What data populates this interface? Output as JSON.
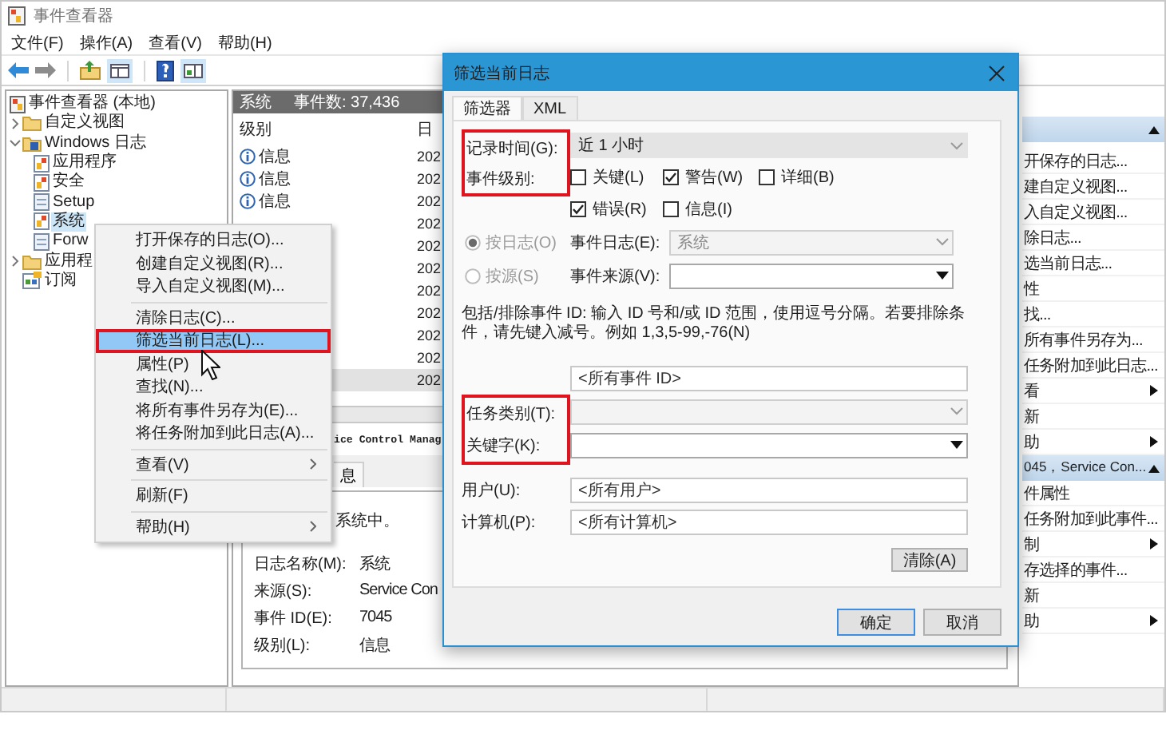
{
  "window": {
    "title": "事件查看器"
  },
  "menu_bar": [
    {
      "label": "文件(F)"
    },
    {
      "label": "操作(A)"
    },
    {
      "label": "查看(V)"
    },
    {
      "label": "帮助(H)"
    }
  ],
  "tree": [
    {
      "label": "事件查看器 (本地)",
      "kind": "root",
      "selected": false,
      "children": [
        {
          "label": "自定义视图",
          "kind": "folder",
          "expanded": false,
          "selected": false
        },
        {
          "label": "Windows 日志",
          "kind": "folder-log",
          "expanded": true,
          "selected": false,
          "children": [
            {
              "label": "应用程序",
              "kind": "log",
              "selected": false
            },
            {
              "label": "安全",
              "kind": "log",
              "selected": false
            },
            {
              "label": "Setup",
              "kind": "plain-log",
              "selected": false
            },
            {
              "label": "系统",
              "kind": "log",
              "selected": true
            },
            {
              "label": "Forw",
              "kind": "plain-log",
              "selected": false
            }
          ]
        },
        {
          "label": "应用程",
          "kind": "folder",
          "expanded": false,
          "selected": false
        },
        {
          "label": "订阅",
          "kind": "subscription",
          "selected": false
        }
      ]
    }
  ],
  "log_panel": {
    "title": "系统",
    "count": "事件数: 37,436",
    "columns": [
      "级别",
      "日"
    ],
    "rows": [
      {
        "level": "信息",
        "date": "202",
        "selected": false
      },
      {
        "level": "信息",
        "date": "202",
        "selected": false
      },
      {
        "level": "信息",
        "date": "202",
        "selected": false
      },
      {
        "date": "202",
        "selected": false
      },
      {
        "date": "202",
        "selected": false
      },
      {
        "date": "202",
        "selected": false
      },
      {
        "date": "202",
        "selected": false
      },
      {
        "date": "202",
        "selected": false
      },
      {
        "date": "202",
        "selected": false
      },
      {
        "date": "202",
        "selected": false
      },
      {
        "date": "202",
        "selected": true
      }
    ],
    "details": {
      "header": "ice Control Manag",
      "tab": "息",
      "message": "系统中。",
      "fields": [
        {
          "label": "日志名称(M):",
          "value": "系统"
        },
        {
          "label": "来源(S):",
          "value": "Service Con"
        },
        {
          "label": "事件 ID(E):",
          "value": "7045"
        },
        {
          "label": "级别(L):",
          "value": "信息"
        }
      ]
    }
  },
  "context_menu": [
    {
      "kind": "item",
      "label": "打开保存的日志(O)...",
      "selected": false,
      "highlighted": false,
      "submenu": false
    },
    {
      "kind": "item",
      "label": "创建自定义视图(R)...",
      "selected": false,
      "highlighted": false,
      "submenu": false
    },
    {
      "kind": "item",
      "label": "导入自定义视图(M)...",
      "selected": false,
      "highlighted": false,
      "submenu": false
    },
    {
      "kind": "separator"
    },
    {
      "kind": "item",
      "label": "清除日志(C)...",
      "selected": false,
      "highlighted": false,
      "submenu": false
    },
    {
      "kind": "item",
      "label": "筛选当前日志(L)...",
      "selected": true,
      "highlighted": true,
      "submenu": false
    },
    {
      "kind": "item",
      "label": "属性(P)",
      "selected": false,
      "highlighted": false,
      "submenu": false
    },
    {
      "kind": "item",
      "label": "查找(N)...",
      "selected": false,
      "highlighted": false,
      "submenu": false
    },
    {
      "kind": "item",
      "label": "将所有事件另存为(E)...",
      "selected": false,
      "highlighted": false,
      "submenu": false
    },
    {
      "kind": "item",
      "label": "将任务附加到此日志(A)...",
      "selected": false,
      "highlighted": false,
      "submenu": false
    },
    {
      "kind": "separator"
    },
    {
      "kind": "item",
      "label": "查看(V)",
      "selected": false,
      "highlighted": false,
      "submenu": true
    },
    {
      "kind": "separator"
    },
    {
      "kind": "item",
      "label": "刷新(F)",
      "selected": false,
      "highlighted": false,
      "submenu": false
    },
    {
      "kind": "separator"
    },
    {
      "kind": "item",
      "label": "帮助(H)",
      "selected": false,
      "highlighted": false,
      "submenu": true
    }
  ],
  "actions": [
    {
      "kind": "header",
      "expanded": true
    },
    {
      "kind": "item",
      "label": "开保存的日志...",
      "submenu": false
    },
    {
      "kind": "item",
      "label": "建自定义视图...",
      "submenu": false
    },
    {
      "kind": "item",
      "label": "入自定义视图...",
      "submenu": false
    },
    {
      "kind": "item",
      "label": "除日志...",
      "submenu": false
    },
    {
      "kind": "item",
      "label": "选当前日志...",
      "submenu": false
    },
    {
      "kind": "item",
      "label": "性",
      "submenu": false
    },
    {
      "kind": "item",
      "label": "找...",
      "submenu": false
    },
    {
      "kind": "item",
      "label": "所有事件另存为...",
      "submenu": false
    },
    {
      "kind": "item",
      "label": "任务附加到此日志...",
      "submenu": false
    },
    {
      "kind": "item",
      "label": "看",
      "submenu": true
    },
    {
      "kind": "item",
      "label": "新",
      "submenu": false
    },
    {
      "kind": "item",
      "label": "助",
      "submenu": true
    },
    {
      "kind": "header",
      "label": "045，Service Con...",
      "expanded": true
    },
    {
      "kind": "item",
      "label": "件属性",
      "submenu": false
    },
    {
      "kind": "item",
      "label": "任务附加到此事件...",
      "submenu": false
    },
    {
      "kind": "item",
      "label": "制",
      "submenu": true
    },
    {
      "kind": "item",
      "label": "存选择的事件...",
      "submenu": false
    },
    {
      "kind": "item",
      "label": "新",
      "submenu": false
    },
    {
      "kind": "item",
      "label": "助",
      "submenu": true
    }
  ],
  "dialog": {
    "title": "筛选当前日志",
    "tabs": [
      {
        "label": "筛选器",
        "selected": true
      },
      {
        "label": "XML",
        "selected": false
      }
    ],
    "time_group": {
      "highlighted": true,
      "time_label": "记录时间(G):",
      "time_value": "近 1 小时",
      "level_label": "事件级别:",
      "levels": [
        {
          "label": "关键(L)",
          "checked": false
        },
        {
          "label": "警告(W)",
          "checked": true
        },
        {
          "label": "详细(B)",
          "checked": false
        },
        {
          "label": "错误(R)",
          "checked": true
        },
        {
          "label": "信息(I)",
          "checked": false
        }
      ]
    },
    "sources": [
      {
        "label": "按日志(O)",
        "selected": true,
        "disabled": true,
        "field_label": "事件日志(E):",
        "value": "系统",
        "field_disabled": true
      },
      {
        "label": "按源(S)",
        "selected": false,
        "disabled": true,
        "field_label": "事件来源(V):",
        "field_disabled": false
      }
    ],
    "description": "包括/排除事件 ID: 输入 ID 号和/或 ID 范围，使用逗号分隔。若要排除条件，请先键入减号。例如 1,3,5-99,-76(N)",
    "event_id": "<所有事件 ID>",
    "task_group": {
      "highlighted": true,
      "task_label": "任务类别(T):",
      "task_disabled": true,
      "keyword_label": "关键字(K):"
    },
    "user": {
      "label": "用户(U):",
      "value": "<所有用户>"
    },
    "computer": {
      "label": "计算机(P):",
      "value": "<所有计算机>"
    },
    "clear_button": "清除(A)",
    "buttons": [
      {
        "label": "确定",
        "default": true
      },
      {
        "label": "取消",
        "default": false
      }
    ]
  }
}
